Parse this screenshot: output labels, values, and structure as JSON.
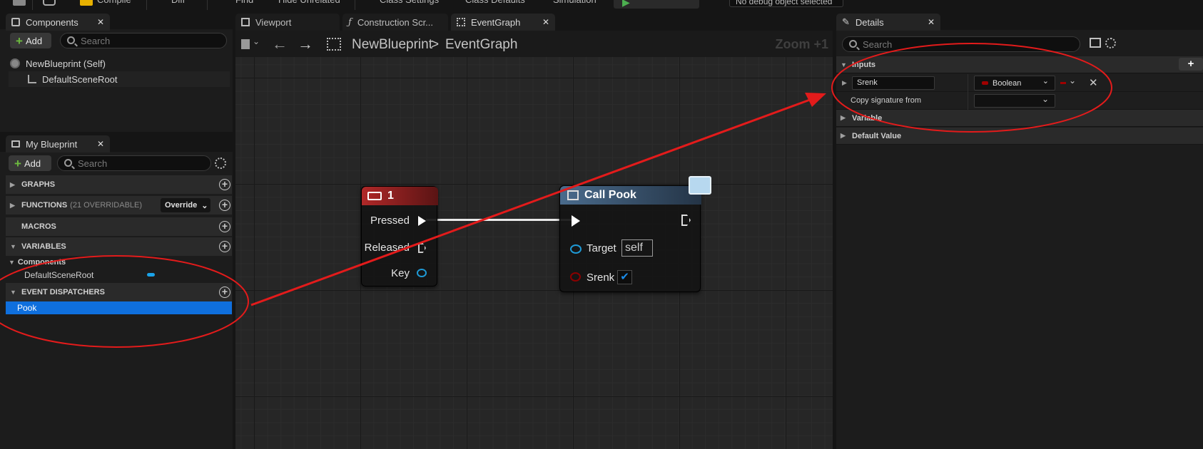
{
  "toolbar": {
    "compile": "Compile",
    "diff": "Diff",
    "find": "Find",
    "hide_unrelated": "Hide Unrelated",
    "class_settings": "Class Settings",
    "class_defaults": "Class Defaults",
    "simulation": "Simulation",
    "debug_object": "No debug object selected"
  },
  "components_panel": {
    "tab_label": "Components",
    "add_label": "Add",
    "search_placeholder": "Search",
    "tree": [
      {
        "label": "NewBlueprint (Self)"
      },
      {
        "label": "DefaultSceneRoot"
      }
    ]
  },
  "my_blueprint_panel": {
    "tab_label": "My Blueprint",
    "add_label": "Add",
    "search_placeholder": "Search",
    "sections": {
      "graphs": "GRAPHS",
      "functions": "FUNCTIONS",
      "functions_sub": "(21 OVERRIDABLE)",
      "override_label": "Override",
      "macros": "MACROS",
      "variables": "VARIABLES",
      "components_category": "Components",
      "component_var": "DefaultSceneRoot",
      "event_dispatchers": "EVENT DISPATCHERS",
      "dispatcher_item": "Pook"
    }
  },
  "editor_tabs": [
    {
      "label": "Viewport"
    },
    {
      "label": "Construction Scr..."
    },
    {
      "label": "EventGraph"
    }
  ],
  "graph": {
    "breadcrumb_root": "NewBlueprint",
    "breadcrumb_separator": ">",
    "breadcrumb_current": "EventGraph",
    "zoom": "Zoom +1",
    "key_node": {
      "title": "1",
      "pins": {
        "pressed": "Pressed",
        "released": "Released",
        "key": "Key"
      }
    },
    "call_node": {
      "title": "Call Pook",
      "pins": {
        "target": "Target",
        "target_value": "self",
        "srenk": "Srenk"
      }
    }
  },
  "details_panel": {
    "tab_label": "Details",
    "search_placeholder": "Search",
    "inputs_section": "Inputs",
    "input_name": "Srenk",
    "input_type": "Boolean",
    "copy_signature_label": "Copy signature from",
    "variable_section": "Variable",
    "default_value_section": "Default Value"
  },
  "colors": {
    "selection_blue": "#0f6fdd",
    "annotation_red": "#e31b1b",
    "boolean_pin": "#8b0000",
    "object_pin": "#1f9ad6",
    "key_node_header": "#8a1a1a",
    "call_node_header": "#3d5a78"
  }
}
